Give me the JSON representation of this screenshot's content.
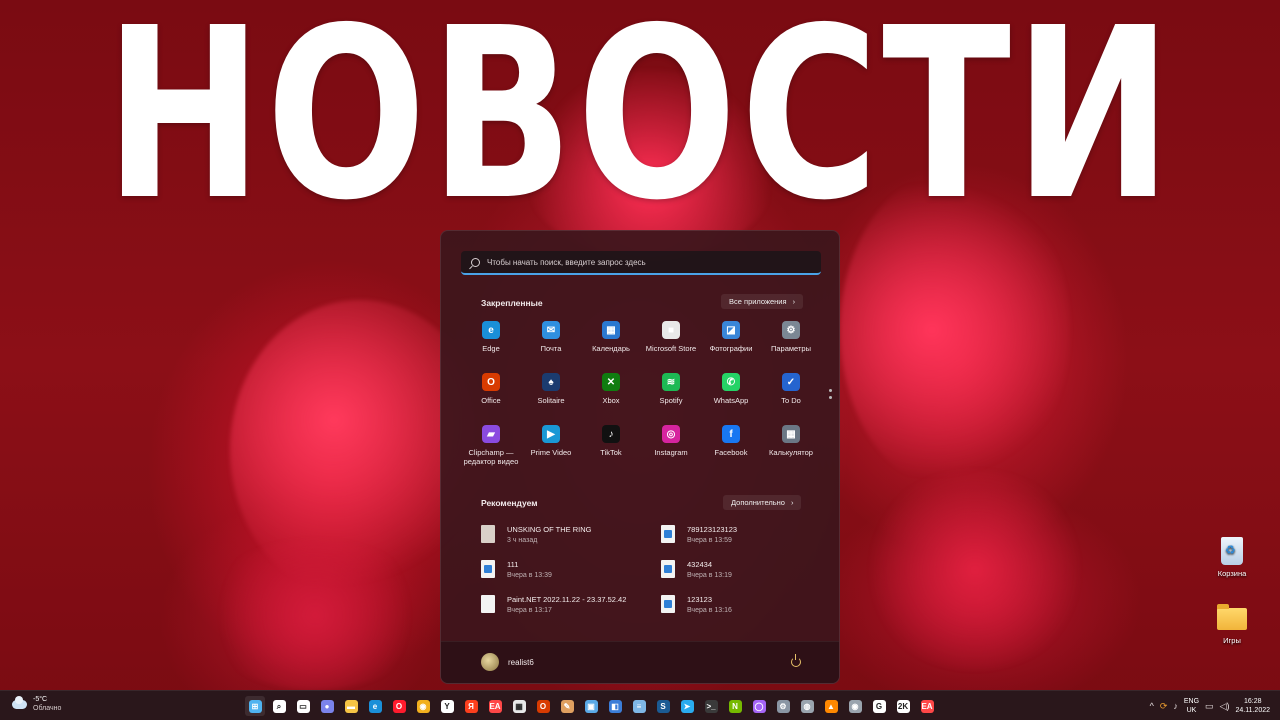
{
  "headline": "НОВОСТИ",
  "start_menu": {
    "search_placeholder": "Чтобы начать поиск, введите запрос здесь",
    "pinned_title": "Закрепленные",
    "all_apps_label": "Все приложения",
    "pinned_apps": [
      {
        "label": "Edge",
        "icon": "edge-icon",
        "color": "#1a8fd8"
      },
      {
        "label": "Почта",
        "icon": "mail-icon",
        "color": "#2f8fe0"
      },
      {
        "label": "Календарь",
        "icon": "calendar-icon",
        "color": "#2b78d0"
      },
      {
        "label": "Microsoft Store",
        "icon": "store-icon",
        "color": "#e8e8e8"
      },
      {
        "label": "Фотографии",
        "icon": "photos-icon",
        "color": "#3a86d8"
      },
      {
        "label": "Параметры",
        "icon": "settings-icon",
        "color": "#7b8794"
      },
      {
        "label": "Office",
        "icon": "office-icon",
        "color": "#d83b01"
      },
      {
        "label": "Solitaire",
        "icon": "solitaire-icon",
        "color": "#1b3b6f"
      },
      {
        "label": "Xbox",
        "icon": "xbox-icon",
        "color": "#107c10"
      },
      {
        "label": "Spotify",
        "icon": "spotify-icon",
        "color": "#1db954"
      },
      {
        "label": "WhatsApp",
        "icon": "whatsapp-icon",
        "color": "#25d366"
      },
      {
        "label": "To Do",
        "icon": "todo-icon",
        "color": "#2564cf"
      },
      {
        "label": "Clipchamp — редактор видео",
        "icon": "clipchamp-icon",
        "color": "#8a4be0"
      },
      {
        "label": "Prime Video",
        "icon": "prime-video-icon",
        "color": "#1a98d5"
      },
      {
        "label": "TikTok",
        "icon": "tiktok-icon",
        "color": "#111111"
      },
      {
        "label": "Instagram",
        "icon": "instagram-icon",
        "color": "#d6249f"
      },
      {
        "label": "Facebook",
        "icon": "facebook-icon",
        "color": "#1877f2"
      },
      {
        "label": "Калькулятор",
        "icon": "calculator-icon",
        "color": "#6b7785"
      }
    ],
    "recommended_title": "Рекомендуем",
    "more_label": "Дополнительно",
    "recommended": [
      {
        "name": "UNSKING OF THE RING",
        "time": "3 ч назад",
        "kind": "game"
      },
      {
        "name": "789123123123",
        "time": "Вчера в 13:59",
        "kind": "img"
      },
      {
        "name": "111",
        "time": "Вчера в 13:39",
        "kind": "img"
      },
      {
        "name": "432434",
        "time": "Вчера в 13:19",
        "kind": "img"
      },
      {
        "name": "Paint.NET 2022.11.22 - 23.37.52.42",
        "time": "Вчера в 13:17",
        "kind": "doc"
      },
      {
        "name": "123123",
        "time": "Вчера в 13:16",
        "kind": "img"
      }
    ],
    "user_name": "realist6"
  },
  "desktop": {
    "recycle_bin": "Корзина",
    "games_folder": "Игры"
  },
  "taskbar": {
    "weather_temp": "-5°C",
    "weather_desc": "Облачно",
    "lang_top": "ENG",
    "lang_bottom": "UK",
    "time": "16:28",
    "date": "24.11.2022",
    "icons": [
      {
        "name": "start-icon",
        "glyph": "⊞",
        "color": "#4fb3f0"
      },
      {
        "name": "search-icon",
        "glyph": "⌕",
        "color": "#ffffff"
      },
      {
        "name": "task-view-icon",
        "glyph": "▭",
        "color": "#ffffff"
      },
      {
        "name": "chat-icon",
        "glyph": "●",
        "color": "#7b83eb"
      },
      {
        "name": "file-explorer-icon",
        "glyph": "▬",
        "color": "#f6c445"
      },
      {
        "name": "edge-icon",
        "glyph": "e",
        "color": "#1a8fd8"
      },
      {
        "name": "opera-icon",
        "glyph": "O",
        "color": "#ff1b2d"
      },
      {
        "name": "chrome-icon",
        "glyph": "◉",
        "color": "#f2b01e"
      },
      {
        "name": "yandex-browser-icon",
        "glyph": "Y",
        "color": "#ffffff"
      },
      {
        "name": "yandex-icon",
        "glyph": "Я",
        "color": "#fc3f1d"
      },
      {
        "name": "ea-icon",
        "glyph": "EA",
        "color": "#ff4747"
      },
      {
        "name": "store-icon",
        "glyph": "▦",
        "color": "#e8e8e8"
      },
      {
        "name": "office-icon",
        "glyph": "O",
        "color": "#d83b01"
      },
      {
        "name": "paint-icon",
        "glyph": "✎",
        "color": "#e0a060"
      },
      {
        "name": "remote-desktop-icon",
        "glyph": "▣",
        "color": "#5aa9e6"
      },
      {
        "name": "paint-net-icon",
        "glyph": "◧",
        "color": "#3b7dd8"
      },
      {
        "name": "notepad-icon",
        "glyph": "≡",
        "color": "#7fb7e6"
      },
      {
        "name": "steam-icon",
        "glyph": "S",
        "color": "#1b5b93"
      },
      {
        "name": "telegram-icon",
        "glyph": "➤",
        "color": "#2aabee"
      },
      {
        "name": "terminal-icon",
        "glyph": ">_",
        "color": "#3a3a3a"
      },
      {
        "name": "nvidia-icon",
        "glyph": "N",
        "color": "#76b900"
      },
      {
        "name": "alice-icon",
        "glyph": "◯",
        "color": "#a565f5"
      },
      {
        "name": "settings-icon",
        "glyph": "⚙",
        "color": "#8a96a4"
      },
      {
        "name": "camera-icon",
        "glyph": "◍",
        "color": "#9aa4ae"
      },
      {
        "name": "vlc-icon",
        "glyph": "▲",
        "color": "#ff8800"
      },
      {
        "name": "xbox-icon",
        "glyph": "◉",
        "color": "#9aa4ae"
      },
      {
        "name": "epic-games-icon",
        "glyph": "G",
        "color": "#ffffff"
      },
      {
        "name": "2k-launcher-icon",
        "glyph": "2K",
        "color": "#ffffff"
      },
      {
        "name": "ea-app-icon",
        "glyph": "EA",
        "color": "#ff4747"
      }
    ]
  }
}
